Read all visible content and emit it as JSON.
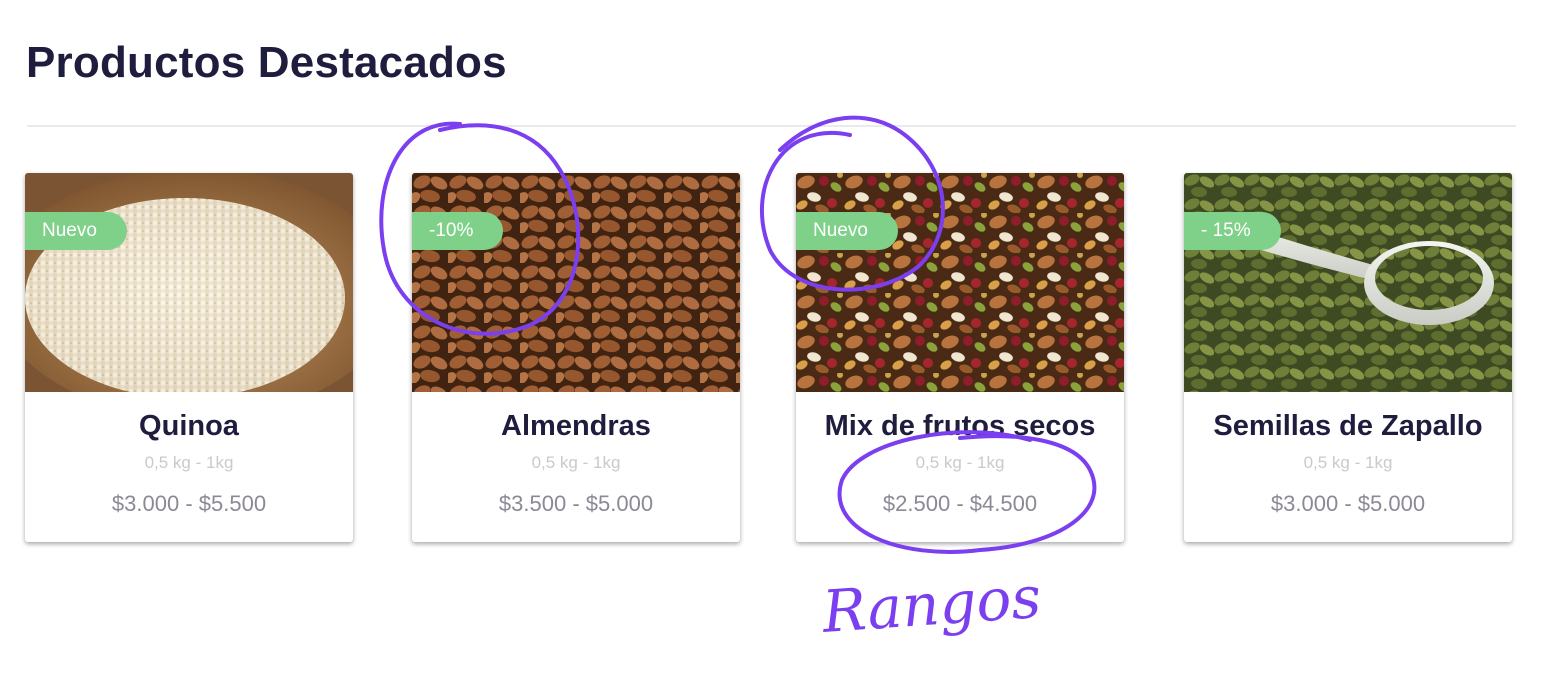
{
  "section": {
    "title": "Productos Destacados"
  },
  "products": [
    {
      "name": "Quinoa",
      "badge": "Nuevo",
      "weight": "0,5 kg - 1kg",
      "price": "$3.000 - $5.500",
      "image": "quinoa-photo"
    },
    {
      "name": "Almendras",
      "badge": "-10%",
      "weight": "0,5 kg - 1kg",
      "price": "$3.500 - $5.000",
      "image": "almonds-photo"
    },
    {
      "name": "Mix de frutos secos",
      "badge": "Nuevo",
      "weight": "0,5 kg - 1kg",
      "price": "$2.500 - $4.500",
      "image": "mixed-nuts-photo"
    },
    {
      "name": "Semillas de Zapallo",
      "badge": "- 15%",
      "weight": "0,5 kg - 1kg",
      "price": "$3.000 - $5.000",
      "image": "pumpkin-seeds-photo"
    }
  ],
  "annotations": {
    "handwritten_note": "Rangos",
    "ink_color": "#7b3ff0"
  },
  "colors": {
    "badge": "#7fd18a",
    "title": "#1f1d3d",
    "price": "#8a8a96",
    "weight": "#c9c9d0"
  }
}
